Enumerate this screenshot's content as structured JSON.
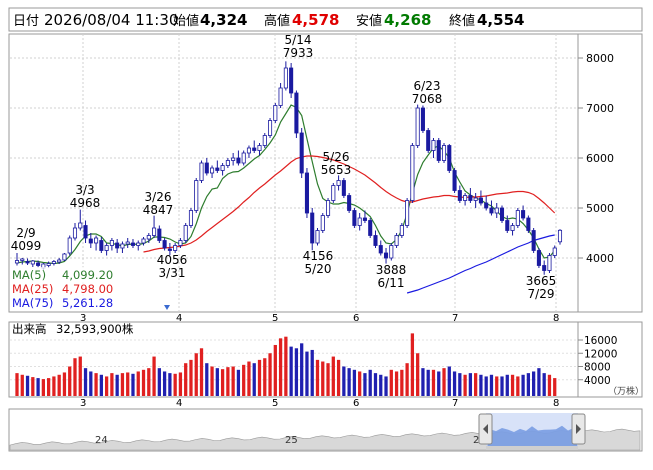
{
  "header": {
    "date_label": "日付",
    "date_value": "2026/08/04 11:30",
    "open_label": "始値",
    "open_value": "4,324",
    "high_label": "高値",
    "high_value": "4,578",
    "low_label": "安値",
    "low_value": "4,268",
    "close_label": "終値",
    "close_value": "4,554"
  },
  "legend": {
    "ma5_label": "MA(5)",
    "ma5_value": "4,099.20",
    "ma25_label": "MA(25)",
    "ma25_value": "4,798.00",
    "ma75_label": "MA(75)",
    "ma75_value": "5,261.28"
  },
  "volume": {
    "label": "出来高",
    "value": "32,593,900株",
    "unit": "（万株）",
    "ticks": [
      "16000",
      "12000",
      "8000",
      "4000"
    ]
  },
  "annotations": [
    {
      "top": "2/9",
      "bottom": "4099"
    },
    {
      "top": "3/3",
      "bottom": "4968"
    },
    {
      "top": "3/26",
      "bottom": "4847"
    },
    {
      "top": "4056",
      "bottom": "3/31"
    },
    {
      "top": "5/14",
      "bottom": "7933"
    },
    {
      "top": "5/26",
      "bottom": "5653"
    },
    {
      "top": "4156",
      "bottom": "5/20"
    },
    {
      "top": "3888",
      "bottom": "6/11"
    },
    {
      "top": "6/23",
      "bottom": "7068"
    },
    {
      "top": "3665",
      "bottom": "7/29"
    }
  ],
  "navigator": {
    "labels": [
      "24",
      "25",
      "26"
    ]
  },
  "colors": {
    "up": "#ffffff",
    "down": "#1a1aa0",
    "ma5": "#2e7d2e",
    "ma25": "#e02020",
    "ma75": "#1a1ae0",
    "vol_up": "#e02020",
    "vol_down": "#2020b0",
    "high_value": "#e00000",
    "low_value": "#007a00"
  },
  "chart_data": {
    "type": "candlestick",
    "y_axis_ticks": [
      4000,
      5000,
      6000,
      7000,
      8000
    ],
    "x_axis_ticks": [
      "3",
      "4",
      "5",
      "6",
      "7",
      "8"
    ],
    "ylim": [
      3000,
      8400
    ],
    "ohlc": [
      [
        3900,
        4099,
        3850,
        3950
      ],
      [
        3950,
        4000,
        3870,
        3980
      ],
      [
        3930,
        3990,
        3860,
        3900
      ],
      [
        3880,
        3960,
        3820,
        3940
      ],
      [
        3900,
        3950,
        3810,
        3850
      ],
      [
        3800,
        3900,
        3760,
        3880
      ],
      [
        3850,
        3930,
        3800,
        3890
      ],
      [
        3890,
        3960,
        3850,
        3930
      ],
      [
        3920,
        4000,
        3880,
        3960
      ],
      [
        3960,
        4100,
        3940,
        4080
      ],
      [
        4100,
        4450,
        4050,
        4400
      ],
      [
        4400,
        4700,
        4350,
        4600
      ],
      [
        4600,
        4968,
        4550,
        4700
      ],
      [
        4650,
        4750,
        4300,
        4400
      ],
      [
        4380,
        4500,
        4200,
        4300
      ],
      [
        4300,
        4450,
        4150,
        4400
      ],
      [
        4350,
        4420,
        4100,
        4150
      ],
      [
        4150,
        4300,
        4050,
        4250
      ],
      [
        4250,
        4400,
        4150,
        4350
      ],
      [
        4300,
        4380,
        4100,
        4200
      ],
      [
        4200,
        4330,
        4100,
        4280
      ],
      [
        4280,
        4400,
        4200,
        4320
      ],
      [
        4300,
        4380,
        4200,
        4250
      ],
      [
        4250,
        4350,
        4150,
        4300
      ],
      [
        4300,
        4420,
        4250,
        4380
      ],
      [
        4380,
        4500,
        4300,
        4450
      ],
      [
        4450,
        4847,
        4400,
        4600
      ],
      [
        4580,
        4650,
        4300,
        4350
      ],
      [
        4350,
        4400,
        4150,
        4200
      ],
      [
        4180,
        4300,
        4056,
        4150
      ],
      [
        4150,
        4300,
        4100,
        4250
      ],
      [
        4250,
        4400,
        4200,
        4350
      ],
      [
        4350,
        4700,
        4300,
        4650
      ],
      [
        4650,
        5000,
        4600,
        4950
      ],
      [
        4950,
        5600,
        4900,
        5550
      ],
      [
        5550,
        5950,
        5500,
        5900
      ],
      [
        5900,
        6000,
        5650,
        5700
      ],
      [
        5700,
        5850,
        5600,
        5800
      ],
      [
        5800,
        5950,
        5700,
        5750
      ],
      [
        5750,
        5900,
        5650,
        5850
      ],
      [
        5850,
        6000,
        5800,
        5950
      ],
      [
        5950,
        6100,
        5850,
        6000
      ],
      [
        6000,
        6150,
        5850,
        5900
      ],
      [
        5900,
        6150,
        5850,
        6100
      ],
      [
        6100,
        6250,
        6000,
        6200
      ],
      [
        6200,
        6350,
        6100,
        6150
      ],
      [
        6150,
        6300,
        6050,
        6250
      ],
      [
        6250,
        6500,
        6200,
        6450
      ],
      [
        6450,
        6800,
        6400,
        6750
      ],
      [
        6750,
        7100,
        6700,
        7050
      ],
      [
        7050,
        7500,
        7000,
        7400
      ],
      [
        7400,
        7933,
        7350,
        7800
      ],
      [
        7800,
        7900,
        7200,
        7300
      ],
      [
        7300,
        7350,
        6400,
        6500
      ],
      [
        6500,
        6600,
        5600,
        5700
      ],
      [
        5700,
        5800,
        4800,
        4900
      ],
      [
        4900,
        5000,
        4156,
        4300
      ],
      [
        4300,
        4600,
        4250,
        4550
      ],
      [
        4550,
        4900,
        4500,
        4850
      ],
      [
        4850,
        5200,
        4800,
        5150
      ],
      [
        5150,
        5500,
        5100,
        5450
      ],
      [
        5450,
        5653,
        5350,
        5550
      ],
      [
        5550,
        5600,
        5200,
        5250
      ],
      [
        5250,
        5300,
        4900,
        4950
      ],
      [
        4950,
        5000,
        4600,
        4650
      ],
      [
        4650,
        4900,
        4550,
        4800
      ],
      [
        4800,
        4950,
        4700,
        4750
      ],
      [
        4750,
        4800,
        4400,
        4450
      ],
      [
        4450,
        4550,
        4200,
        4250
      ],
      [
        4250,
        4350,
        4050,
        4100
      ],
      [
        4100,
        4200,
        3888,
        4000
      ],
      [
        4000,
        4300,
        3950,
        4250
      ],
      [
        4250,
        4500,
        4200,
        4450
      ],
      [
        4450,
        4700,
        4400,
        4650
      ],
      [
        4650,
        5200,
        4600,
        5150
      ],
      [
        5150,
        6300,
        5100,
        6250
      ],
      [
        6250,
        7068,
        6200,
        7000
      ],
      [
        7000,
        7050,
        6500,
        6550
      ],
      [
        6550,
        6600,
        6100,
        6150
      ],
      [
        6150,
        6400,
        6000,
        6350
      ],
      [
        6350,
        6400,
        5900,
        5950
      ],
      [
        5950,
        6300,
        5900,
        6250
      ],
      [
        6250,
        6280,
        5700,
        5750
      ],
      [
        5750,
        5800,
        5300,
        5350
      ],
      [
        5350,
        5450,
        5100,
        5150
      ],
      [
        5150,
        5300,
        5050,
        5250
      ],
      [
        5250,
        5400,
        5100,
        5150
      ],
      [
        5150,
        5300,
        5000,
        5200
      ],
      [
        5200,
        5350,
        5050,
        5100
      ],
      [
        5100,
        5250,
        4950,
        5000
      ],
      [
        5000,
        5150,
        4850,
        4900
      ],
      [
        4900,
        5100,
        4800,
        5000
      ],
      [
        5000,
        5050,
        4700,
        4750
      ],
      [
        4750,
        4850,
        4500,
        4550
      ],
      [
        4550,
        4700,
        4450,
        4650
      ],
      [
        4650,
        5000,
        4600,
        4950
      ],
      [
        4950,
        5050,
        4750,
        4800
      ],
      [
        4800,
        4850,
        4500,
        4550
      ],
      [
        4550,
        4600,
        4100,
        4150
      ],
      [
        4150,
        4200,
        3800,
        3850
      ],
      [
        3850,
        3950,
        3665,
        3750
      ],
      [
        3750,
        4100,
        3700,
        4050
      ],
      [
        4050,
        4250,
        4000,
        4200
      ],
      [
        4324,
        4578,
        4268,
        4554
      ]
    ],
    "series": [
      {
        "name": "MA(5)",
        "values": [
          3900,
          3920,
          3930,
          3940,
          3930,
          3910,
          3900,
          3890,
          3900,
          3930,
          4040,
          4170,
          4330,
          4440,
          4480,
          4480,
          4430,
          4300,
          4290,
          4270,
          4240,
          4270,
          4280,
          4270,
          4290,
          4340,
          4420,
          4420,
          4410,
          4380,
          4320,
          4280,
          4300,
          4430,
          4680,
          5000,
          5230,
          5380,
          5400,
          5590,
          5680,
          5720,
          5730,
          5800,
          5890,
          5980,
          6050,
          6170,
          6300,
          6460,
          6720,
          6890,
          7060,
          7010,
          6850,
          6380,
          5930,
          5480,
          5190,
          5120,
          5080,
          5080,
          5110,
          5090,
          5060,
          5000,
          4920,
          4830,
          4650,
          4440,
          4300,
          4280,
          4370,
          4560,
          4890,
          5300,
          5670,
          5910,
          6060,
          6200,
          6240,
          6140,
          6000,
          5710,
          5520,
          5340,
          5260,
          5200,
          5160,
          5090,
          5040,
          4940,
          4830,
          4780,
          4800,
          4780,
          4690,
          4560,
          4400,
          4180,
          4000,
          4020,
          4150
        ]
      },
      {
        "name": "MA(25)",
        "values": [
          null,
          null,
          null,
          null,
          null,
          null,
          null,
          null,
          null,
          null,
          null,
          null,
          null,
          null,
          null,
          null,
          null,
          null,
          null,
          null,
          null,
          null,
          null,
          null,
          4120,
          4140,
          4170,
          4190,
          4200,
          4210,
          4220,
          4240,
          4260,
          4300,
          4360,
          4440,
          4530,
          4610,
          4690,
          4770,
          4850,
          4930,
          5020,
          5120,
          5210,
          5310,
          5400,
          5480,
          5570,
          5660,
          5740,
          5830,
          5920,
          5990,
          6020,
          6040,
          6040,
          6030,
          6010,
          5990,
          5960,
          5920,
          5880,
          5830,
          5780,
          5720,
          5660,
          5580,
          5500,
          5410,
          5330,
          5260,
          5200,
          5150,
          5120,
          5120,
          5150,
          5180,
          5200,
          5220,
          5230,
          5250,
          5250,
          5230,
          5220,
          5210,
          5220,
          5220,
          5230,
          5240,
          5260,
          5280,
          5290,
          5300,
          5320,
          5330,
          5330,
          5310,
          5270,
          5190,
          5100,
          5000,
          4900
        ]
      },
      {
        "name": "MA(75)",
        "values": [
          null,
          null,
          null,
          null,
          null,
          null,
          null,
          null,
          null,
          null,
          null,
          null,
          null,
          null,
          null,
          null,
          null,
          null,
          null,
          null,
          null,
          null,
          null,
          null,
          null,
          null,
          null,
          null,
          null,
          null,
          null,
          null,
          null,
          null,
          null,
          null,
          null,
          null,
          null,
          null,
          null,
          null,
          null,
          null,
          null,
          null,
          null,
          null,
          null,
          null,
          null,
          null,
          null,
          null,
          null,
          null,
          null,
          null,
          null,
          null,
          null,
          null,
          null,
          null,
          null,
          null,
          null,
          null,
          null,
          null,
          null,
          null,
          null,
          null,
          3300,
          3330,
          3360,
          3400,
          3440,
          3480,
          3520,
          3560,
          3600,
          3650,
          3700,
          3750,
          3790,
          3840,
          3880,
          3920,
          3970,
          4020,
          4070,
          4120,
          4170,
          4220,
          4260,
          4300,
          4350,
          4380,
          4410,
          4440,
          4460
        ]
      }
    ],
    "volume": [
      6000,
      5500,
      5200,
      4800,
      4500,
      4200,
      4500,
      5000,
      5500,
      6200,
      8000,
      10500,
      11000,
      7500,
      6500,
      6000,
      5500,
      5000,
      6000,
      5500,
      6000,
      6200,
      5800,
      6500,
      7000,
      7500,
      11000,
      7500,
      6500,
      6000,
      5800,
      6200,
      9000,
      10000,
      12000,
      13500,
      9000,
      8000,
      7500,
      7200,
      7800,
      8000,
      7000,
      8500,
      9500,
      9000,
      10000,
      10500,
      12000,
      14500,
      16500,
      17000,
      14000,
      13500,
      15000,
      12500,
      13000,
      10000,
      9500,
      9000,
      11000,
      10000,
      8000,
      7500,
      7000,
      6500,
      6000,
      7000,
      6000,
      5500,
      5000,
      7000,
      6500,
      7000,
      9000,
      18000,
      12000,
      7500,
      7000,
      7000,
      6500,
      7500,
      8000,
      6500,
      6000,
      5500,
      6000,
      6000,
      5500,
      5000,
      5500,
      5000,
      5000,
      5500,
      5500,
      5000,
      5500,
      6000,
      6500,
      7500,
      6000,
      5500,
      4500
    ]
  }
}
